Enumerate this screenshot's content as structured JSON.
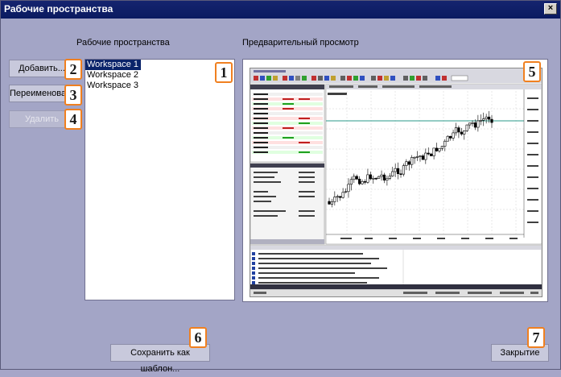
{
  "window": {
    "title": "Рабочие пространства",
    "close_glyph": "×"
  },
  "labels": {
    "workspaces": "Рабочие пространства",
    "preview": "Предварительный просмотр"
  },
  "buttons": {
    "add": "Добавить...",
    "rename": "Переименовать",
    "delete": "Удалить",
    "save_template": "Сохранить как шаблон...",
    "close": "Закрытие"
  },
  "workspaces": [
    {
      "name": "Workspace 1",
      "selected": true
    },
    {
      "name": "Workspace 2",
      "selected": false
    },
    {
      "name": "Workspace 3",
      "selected": false
    }
  ],
  "callouts": [
    "1",
    "2",
    "3",
    "4",
    "5",
    "6",
    "7"
  ],
  "colors": {
    "window_bg": "#a3a5c6",
    "titlebar": "#0a1a60",
    "selection": "#0a246a",
    "callout_border": "#f08020",
    "candle_up": "#ffffff",
    "candle_down": "#000000",
    "level_line": "#2a9a8a"
  }
}
